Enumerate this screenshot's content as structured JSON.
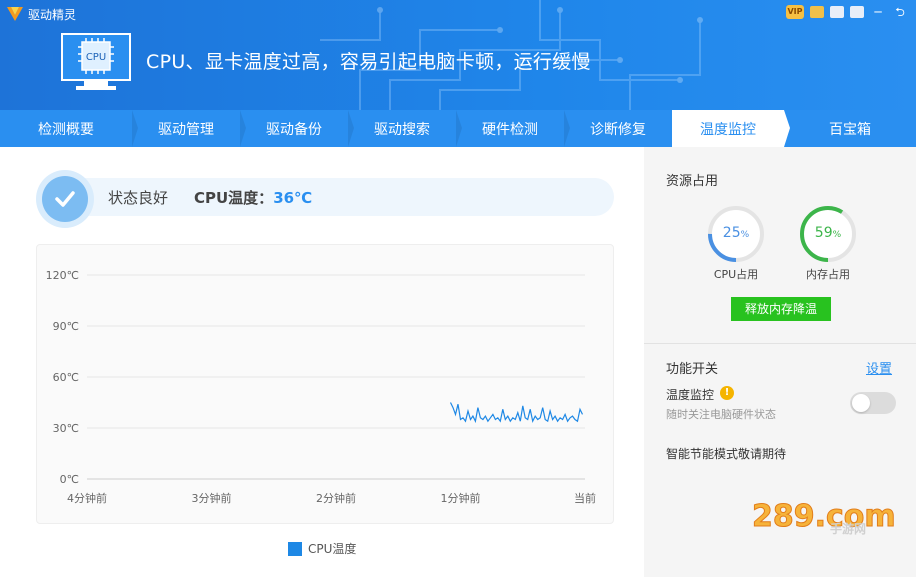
{
  "app": {
    "name": "驱动精灵"
  },
  "header": {
    "headline": "CPU、显卡温度过高，容易引起电脑卡顿，运行缓慢",
    "cpu_chip_label": "CPU",
    "icons": [
      "vip-icon",
      "gift-icon",
      "skin-icon",
      "menu-icon",
      "minimize-icon",
      "close-icon"
    ],
    "back_glyph": "⮌"
  },
  "tabs": [
    {
      "label": "检测概要"
    },
    {
      "label": "驱动管理"
    },
    {
      "label": "驱动备份"
    },
    {
      "label": "驱动搜索"
    },
    {
      "label": "硬件检测"
    },
    {
      "label": "诊断修复"
    },
    {
      "label": "温度监控",
      "active": true
    },
    {
      "label": "百宝箱"
    }
  ],
  "status": {
    "text": "状态良好",
    "temp_prefix": "CPU温度：",
    "temp_value": "36℃"
  },
  "chart_data": {
    "type": "line",
    "title": "",
    "xlabel": "",
    "ylabel": "",
    "y_ticks": [
      "120℃",
      "90℃",
      "60℃",
      "30℃",
      "0℃"
    ],
    "x_ticks": [
      "4分钟前",
      "3分钟前",
      "2分钟前",
      "1分钟前",
      "当前"
    ],
    "ylim": [
      0,
      120
    ],
    "xlim_minutes_ago": [
      4,
      0
    ],
    "series": [
      {
        "name": "CPU温度",
        "color": "#1e88e5",
        "x_minutes_ago": [
          1.08,
          1.06,
          1.04,
          1.02,
          1.0,
          0.98,
          0.96,
          0.94,
          0.92,
          0.9,
          0.88,
          0.86,
          0.84,
          0.82,
          0.8,
          0.78,
          0.76,
          0.74,
          0.72,
          0.7,
          0.68,
          0.66,
          0.64,
          0.62,
          0.6,
          0.58,
          0.56,
          0.54,
          0.52,
          0.5,
          0.48,
          0.46,
          0.44,
          0.42,
          0.4,
          0.38,
          0.36,
          0.34,
          0.32,
          0.3,
          0.28,
          0.26,
          0.24,
          0.22,
          0.2,
          0.18,
          0.16,
          0.14,
          0.12,
          0.1,
          0.08,
          0.06,
          0.04,
          0.02
        ],
        "values": [
          45,
          42,
          38,
          44,
          35,
          36,
          34,
          40,
          35,
          37,
          34,
          42,
          36,
          35,
          37,
          34,
          36,
          38,
          35,
          36,
          34,
          41,
          35,
          37,
          34,
          36,
          35,
          39,
          34,
          43,
          36,
          35,
          41,
          34,
          37,
          35,
          36,
          42,
          35,
          34,
          40,
          35,
          37,
          34,
          36,
          35,
          38,
          34,
          36,
          37,
          35,
          34,
          41,
          38
        ]
      }
    ],
    "legend": "bottom-center",
    "grid": true
  },
  "right": {
    "resource_title": "资源占用",
    "cpu_gauge": {
      "value": 25,
      "value_text": "25",
      "unit": "%",
      "label": "CPU占用",
      "color": "#4a90e2"
    },
    "mem_gauge": {
      "value": 59,
      "value_text": "59",
      "unit": "%",
      "label": "内存占用",
      "color": "#3cb54a"
    },
    "release_button": "释放内存降温",
    "feature_title": "功能开关",
    "settings_link": "设置",
    "monitor_title": "温度监控",
    "monitor_sub": "随时关注电脑硬件状态",
    "toggle_on": false,
    "smart_note": "智能节能模式敬请期待"
  },
  "watermark": {
    "text": "手游网",
    "logo": "289.com"
  }
}
